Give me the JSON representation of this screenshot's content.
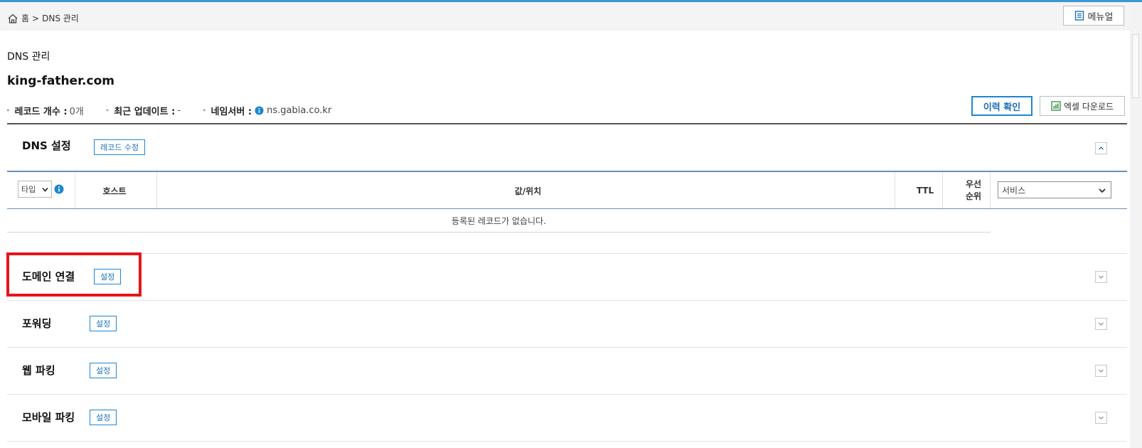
{
  "breadcrumb": {
    "home": "홈",
    "separator": ">",
    "current": "DNS 관리"
  },
  "header": {
    "manual_label": "메뉴얼"
  },
  "page": {
    "subtitle": "DNS 관리",
    "domain": "king-father.com",
    "record_count_label": "레코드 개수 :",
    "record_count_value": "0개",
    "last_update_label": "최근 업데이트 :",
    "last_update_value": "-",
    "nameserver_label": "네임서버 :",
    "nameserver_value": "ns.gabia.co.kr",
    "history_button": "이력 확인",
    "excel_button": "엑셀 다운로드"
  },
  "dns_section": {
    "title": "DNS 설정",
    "edit_button": "레코드 수정",
    "table": {
      "type_select": "타입",
      "columns": {
        "host": "호스트",
        "value": "값/위치",
        "ttl": "TTL",
        "priority_line1": "우선",
        "priority_line2": "순위"
      },
      "service_select": "서비스",
      "empty_message": "등록된 레코드가 없습니다."
    }
  },
  "sections": [
    {
      "title": "도메인 연결",
      "button": "설정"
    },
    {
      "title": "포워딩",
      "button": "설정"
    },
    {
      "title": "웹 파킹",
      "button": "설정"
    },
    {
      "title": "모바일 파킹",
      "button": "설정"
    }
  ],
  "colors": {
    "accent": "#1f86cf",
    "highlight": "#e8141a",
    "info": "#1f86cf"
  },
  "icons": {
    "home": "home-icon",
    "manual": "document-icon",
    "info": "info-icon",
    "excel": "excel-icon",
    "collapse": "chevron-up-icon",
    "expand": "chevron-down-icon"
  }
}
